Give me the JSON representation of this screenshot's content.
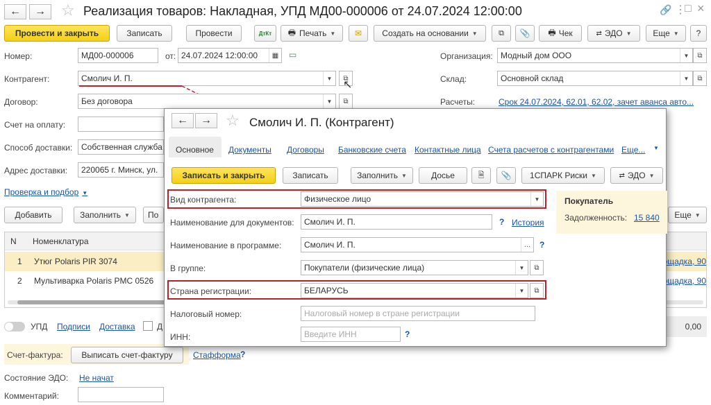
{
  "main": {
    "title": "Реализация товаров: Накладная, УПД МД00-000006 от 24.07.2024 12:00:00",
    "nav_back": "←",
    "nav_forward": "→",
    "toolbar": {
      "post_close": "Провести и закрыть",
      "save": "Записать",
      "post": "Провести",
      "print": "Печать",
      "create_based": "Создать на основании",
      "receipt": "Чек",
      "edo": "ЭДО",
      "more": "Еще",
      "dtkt": "ДтКт",
      "help": "?"
    },
    "fields": {
      "number_label": "Номер:",
      "number_value": "МД00-000006",
      "date_label": "от:",
      "date_value": "24.07.2024 12:00:00",
      "org_label": "Организация:",
      "org_value": "Модный дом ООО",
      "counterparty_label": "Контрагент:",
      "counterparty_value": "Смолич И. П.",
      "warehouse_label": "Склад:",
      "warehouse_value": "Основной склад",
      "contract_label": "Договор:",
      "contract_value": "Без договора",
      "payments_label": "Расчеты:",
      "payments_value": "Срок 24.07.2024, 62.01, 62.02, зачет аванса авто...",
      "invoice_label": "Счет на оплату:",
      "delivery_label": "Способ доставки:",
      "delivery_value": "Собственная служба",
      "address_label": "Адрес доставки:",
      "address_value": "220065 г. Минск, ул.",
      "check_link": "Проверка и подбор"
    },
    "table_toolbar": {
      "add": "Добавить",
      "fill": "Заполнить",
      "po": "По",
      "more": "Еще"
    },
    "table": {
      "col_n": "N",
      "col_item": "Номенклатура",
      "rows": [
        {
          "n": "1",
          "item": "Утюг Polaris PIR 3074",
          "right": "ощадка, 90"
        },
        {
          "n": "2",
          "item": "Мультиварка Polaris PMC 0526",
          "right": "ощадка, 90"
        }
      ]
    },
    "bottom": {
      "upd_label": "УПД",
      "signatures_link": "Подписи",
      "delivery_link": "Доставка",
      "d_label": "Д",
      "total_value": "0,00",
      "invoice_label": "Счет-фактура:",
      "invoice_button": "Выписать счет-фактуру",
      "staforma_link": "Стафформа",
      "help": "?",
      "edo_state_label": "Состояние ЭДО:",
      "edo_state_link": "Не начат",
      "comment_label": "Комментарий:"
    }
  },
  "dialog": {
    "title": "Смолич И. П. (Контрагент)",
    "nav_back": "←",
    "nav_forward": "→",
    "tabs": [
      "Основное",
      "Документы",
      "Договоры",
      "Банковские счета",
      "Контактные лица",
      "Счета расчетов с контрагентами",
      "Еще..."
    ],
    "toolbar": {
      "save_close": "Записать и закрыть",
      "save": "Записать",
      "fill": "Заполнить",
      "dossier": "Досье",
      "spark": "1СПАРК Риски",
      "edo": "ЭДО"
    },
    "fields": {
      "kind_label": "Вид контрагента:",
      "kind_value": "Физическое лицо",
      "docname_label": "Наименование для документов:",
      "docname_value": "Смолич И. П.",
      "history_link": "История",
      "progname_label": "Наименование в программе:",
      "progname_value": "Смолич И. П.",
      "group_label": "В группе:",
      "group_value": "Покупатели (физические лица)",
      "country_label": "Страна регистрации:",
      "country_value": "БЕЛАРУСЬ",
      "tax_label": "Налоговый номер:",
      "tax_placeholder": "Налоговый номер в стране регистрации",
      "inn_label": "ИНН:",
      "inn_placeholder": "Введите ИНН",
      "help": "?"
    },
    "buyer_panel": {
      "title": "Покупатель",
      "debt_label": "Задолженность:",
      "debt_value": "15 840"
    }
  },
  "colors": {
    "accent_yellow": "#f5cf16",
    "link_blue": "#1a55a8",
    "highlight_red": "#b8202a",
    "selected_row": "#fbeec4"
  }
}
